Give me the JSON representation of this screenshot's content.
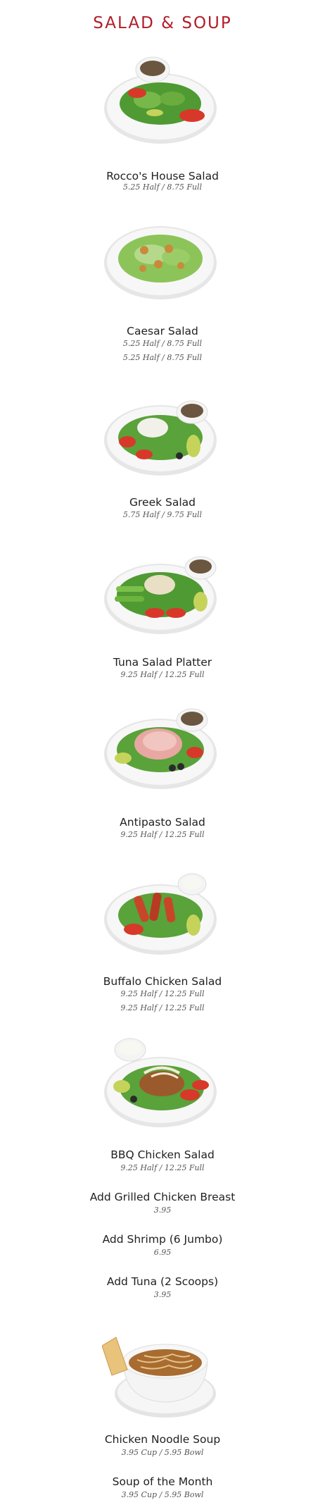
{
  "page": {
    "title": "SALAD & SOUP"
  },
  "colors": {
    "title": "#b11d28",
    "plate": "#f4f4f4",
    "lettuce": "#5aa23a",
    "tomato": "#d8382a",
    "dressing": "#6b5640"
  },
  "items": [
    {
      "name": "Rocco's House Salad",
      "prices": [
        "5.25 Half / 8.75 Full"
      ],
      "image": "house-salad-image"
    },
    {
      "name": "Caesar Salad",
      "prices": [
        "5.25 Half / 8.75 Full",
        "5.25 Half / 8.75 Full"
      ],
      "image": "caesar-salad-image"
    },
    {
      "name": "Greek Salad",
      "prices": [
        "5.75 Half / 9.75 Full"
      ],
      "image": "greek-salad-image"
    },
    {
      "name": "Tuna Salad Platter",
      "prices": [
        "9.25 Half / 12.25 Full"
      ],
      "image": "tuna-salad-image"
    },
    {
      "name": "Antipasto Salad",
      "prices": [
        "9.25 Half / 12.25 Full"
      ],
      "image": "antipasto-salad-image"
    },
    {
      "name": "Buffalo Chicken Salad",
      "prices": [
        "9.25 Half / 12.25 Full",
        "9.25 Half / 12.25 Full"
      ],
      "image": "buffalo-chicken-salad-image"
    },
    {
      "name": "BBQ Chicken Salad",
      "prices": [
        "9.25 Half / 12.25 Full"
      ],
      "image": "bbq-chicken-salad-image"
    }
  ],
  "addons": [
    {
      "name": "Add Grilled Chicken Breast",
      "price": "3.95"
    },
    {
      "name": "Add Shrimp (6 Jumbo)",
      "price": "6.95"
    },
    {
      "name": "Add Tuna (2 Scoops)",
      "price": "3.95"
    }
  ],
  "soups": [
    {
      "name": "Chicken Noodle Soup",
      "price": "3.95 Cup / 5.95 Bowl",
      "image": "soup-bowl-image"
    },
    {
      "name": "Soup of the Month",
      "price": "3.95 Cup / 5.95 Bowl"
    }
  ]
}
